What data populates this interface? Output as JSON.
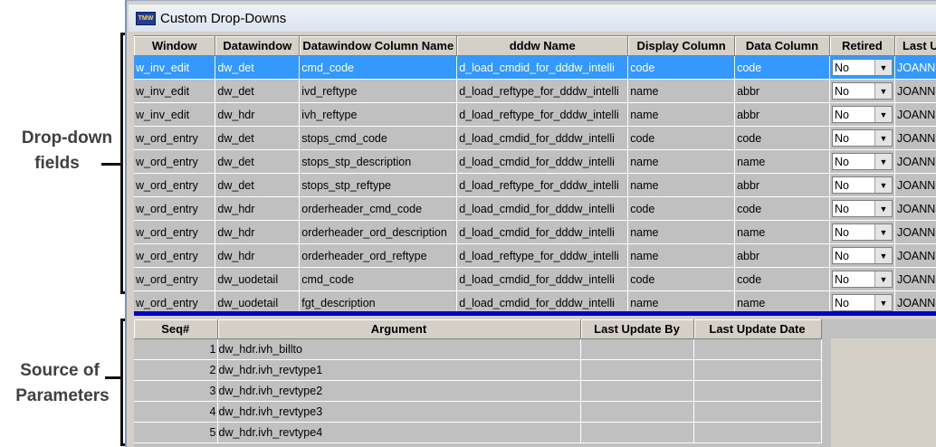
{
  "annotations": {
    "dropdown_label_line1": "Drop-down",
    "dropdown_label_line2": "fields",
    "source_label_line1": "Source of",
    "source_label_line2": "Parameters"
  },
  "window": {
    "title": "Custom Drop-Downs",
    "icon": "app-logo-icon"
  },
  "top_grid": {
    "columns": [
      "Window",
      "Datawindow",
      "Datawindow Column Name",
      "dddw Name",
      "Display Column",
      "Data Column",
      "Retired",
      "Last U"
    ],
    "rows": [
      {
        "window": "w_inv_edit",
        "datawindow": "dw_det",
        "column": "cmd_code",
        "dddw": "d_load_cmdid_for_dddw_intelli",
        "display": "code",
        "data": "code",
        "retired": "No",
        "last": "JOANNI"
      },
      {
        "window": "w_inv_edit",
        "datawindow": "dw_det",
        "column": "ivd_reftype",
        "dddw": "d_load_reftype_for_dddw_intelli",
        "display": "name",
        "data": "abbr",
        "retired": "No",
        "last": "JOANNI"
      },
      {
        "window": "w_inv_edit",
        "datawindow": "dw_hdr",
        "column": "ivh_reftype",
        "dddw": "d_load_reftype_for_dddw_intelli",
        "display": "name",
        "data": "abbr",
        "retired": "No",
        "last": "JOANNI"
      },
      {
        "window": "w_ord_entry",
        "datawindow": "dw_det",
        "column": "stops_cmd_code",
        "dddw": "d_load_cmdid_for_dddw_intelli",
        "display": "code",
        "data": "code",
        "retired": "No",
        "last": "JOANNI"
      },
      {
        "window": "w_ord_entry",
        "datawindow": "dw_det",
        "column": "stops_stp_description",
        "dddw": "d_load_cmdid_for_dddw_intelli",
        "display": "name",
        "data": "name",
        "retired": "No",
        "last": "JOANNI"
      },
      {
        "window": "w_ord_entry",
        "datawindow": "dw_det",
        "column": "stops_stp_reftype",
        "dddw": "d_load_reftype_for_dddw_intelli",
        "display": "name",
        "data": "abbr",
        "retired": "No",
        "last": "JOANNI"
      },
      {
        "window": "w_ord_entry",
        "datawindow": "dw_hdr",
        "column": "orderheader_cmd_code",
        "dddw": "d_load_cmdid_for_dddw_intelli",
        "display": "code",
        "data": "code",
        "retired": "No",
        "last": "JOANNI"
      },
      {
        "window": "w_ord_entry",
        "datawindow": "dw_hdr",
        "column": "orderheader_ord_description",
        "dddw": "d_load_cmdid_for_dddw_intelli",
        "display": "name",
        "data": "name",
        "retired": "No",
        "last": "JOANNI"
      },
      {
        "window": "w_ord_entry",
        "datawindow": "dw_hdr",
        "column": "orderheader_ord_reftype",
        "dddw": "d_load_reftype_for_dddw_intelli",
        "display": "name",
        "data": "abbr",
        "retired": "No",
        "last": "JOANNI"
      },
      {
        "window": "w_ord_entry",
        "datawindow": "dw_uodetail",
        "column": "cmd_code",
        "dddw": "d_load_cmdid_for_dddw_intelli",
        "display": "code",
        "data": "code",
        "retired": "No",
        "last": "JOANNI"
      },
      {
        "window": "w_ord_entry",
        "datawindow": "dw_uodetail",
        "column": "fgt_description",
        "dddw": "d_load_cmdid_for_dddw_intelli",
        "display": "name",
        "data": "name",
        "retired": "No",
        "last": "JOANNI"
      }
    ],
    "selected_row": 0
  },
  "bottom_grid": {
    "columns": [
      "Seq#",
      "Argument",
      "Last Update By",
      "Last Update Date"
    ],
    "rows": [
      {
        "seq": "1",
        "argument": "dw_hdr.ivh_billto",
        "by": "",
        "date": ""
      },
      {
        "seq": "2",
        "argument": "dw_hdr.ivh_revtype1",
        "by": "",
        "date": ""
      },
      {
        "seq": "3",
        "argument": "dw_hdr.ivh_revtype2",
        "by": "",
        "date": ""
      },
      {
        "seq": "4",
        "argument": "dw_hdr.ivh_revtype3",
        "by": "",
        "date": ""
      },
      {
        "seq": "5",
        "argument": "dw_hdr.ivh_revtype4",
        "by": "",
        "date": ""
      }
    ]
  },
  "colors": {
    "selection": "#3399ff",
    "splitter": "#0000c8",
    "grid_bg": "#c0c0c0"
  }
}
